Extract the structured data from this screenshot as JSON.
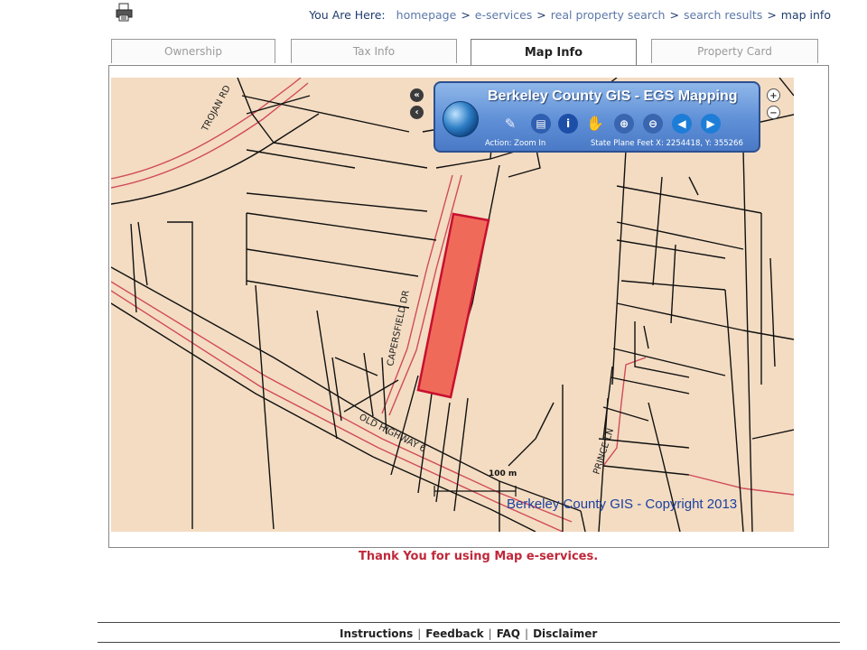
{
  "breadcrumb": {
    "label": "You Are Here:",
    "items": [
      "homepage",
      "e-services",
      "real property search",
      "search results"
    ],
    "current": "map info"
  },
  "tabs": [
    {
      "label": "Ownership"
    },
    {
      "label": "Tax Info"
    },
    {
      "label": "Map Info"
    },
    {
      "label": "Property Card"
    }
  ],
  "active_tab": "Map Info",
  "gis_toolbar": {
    "title": "Berkeley County GIS - EGS Mapping",
    "action": "Action: Zoom In",
    "coords": "State Plane Feet  X: 2254418,  Y: 355266"
  },
  "map": {
    "street_labels": [
      "TROJAN RD",
      "CAPERSFIELD DR",
      "OLD HIGHWAY 6",
      "PRINCE LN"
    ],
    "scale_label": "100 m",
    "copyright": "Berkeley County GIS - Copyright 2013",
    "highlight_color": "#f06a5a",
    "road_color": "#d24a5a",
    "parcel_line_color": "#111111",
    "background_color": "#f3dcc2"
  },
  "thank_you": "Thank You for using Map e-services.",
  "footer": {
    "links": [
      "Instructions",
      "Feedback",
      "FAQ",
      "Disclaimer"
    ]
  }
}
